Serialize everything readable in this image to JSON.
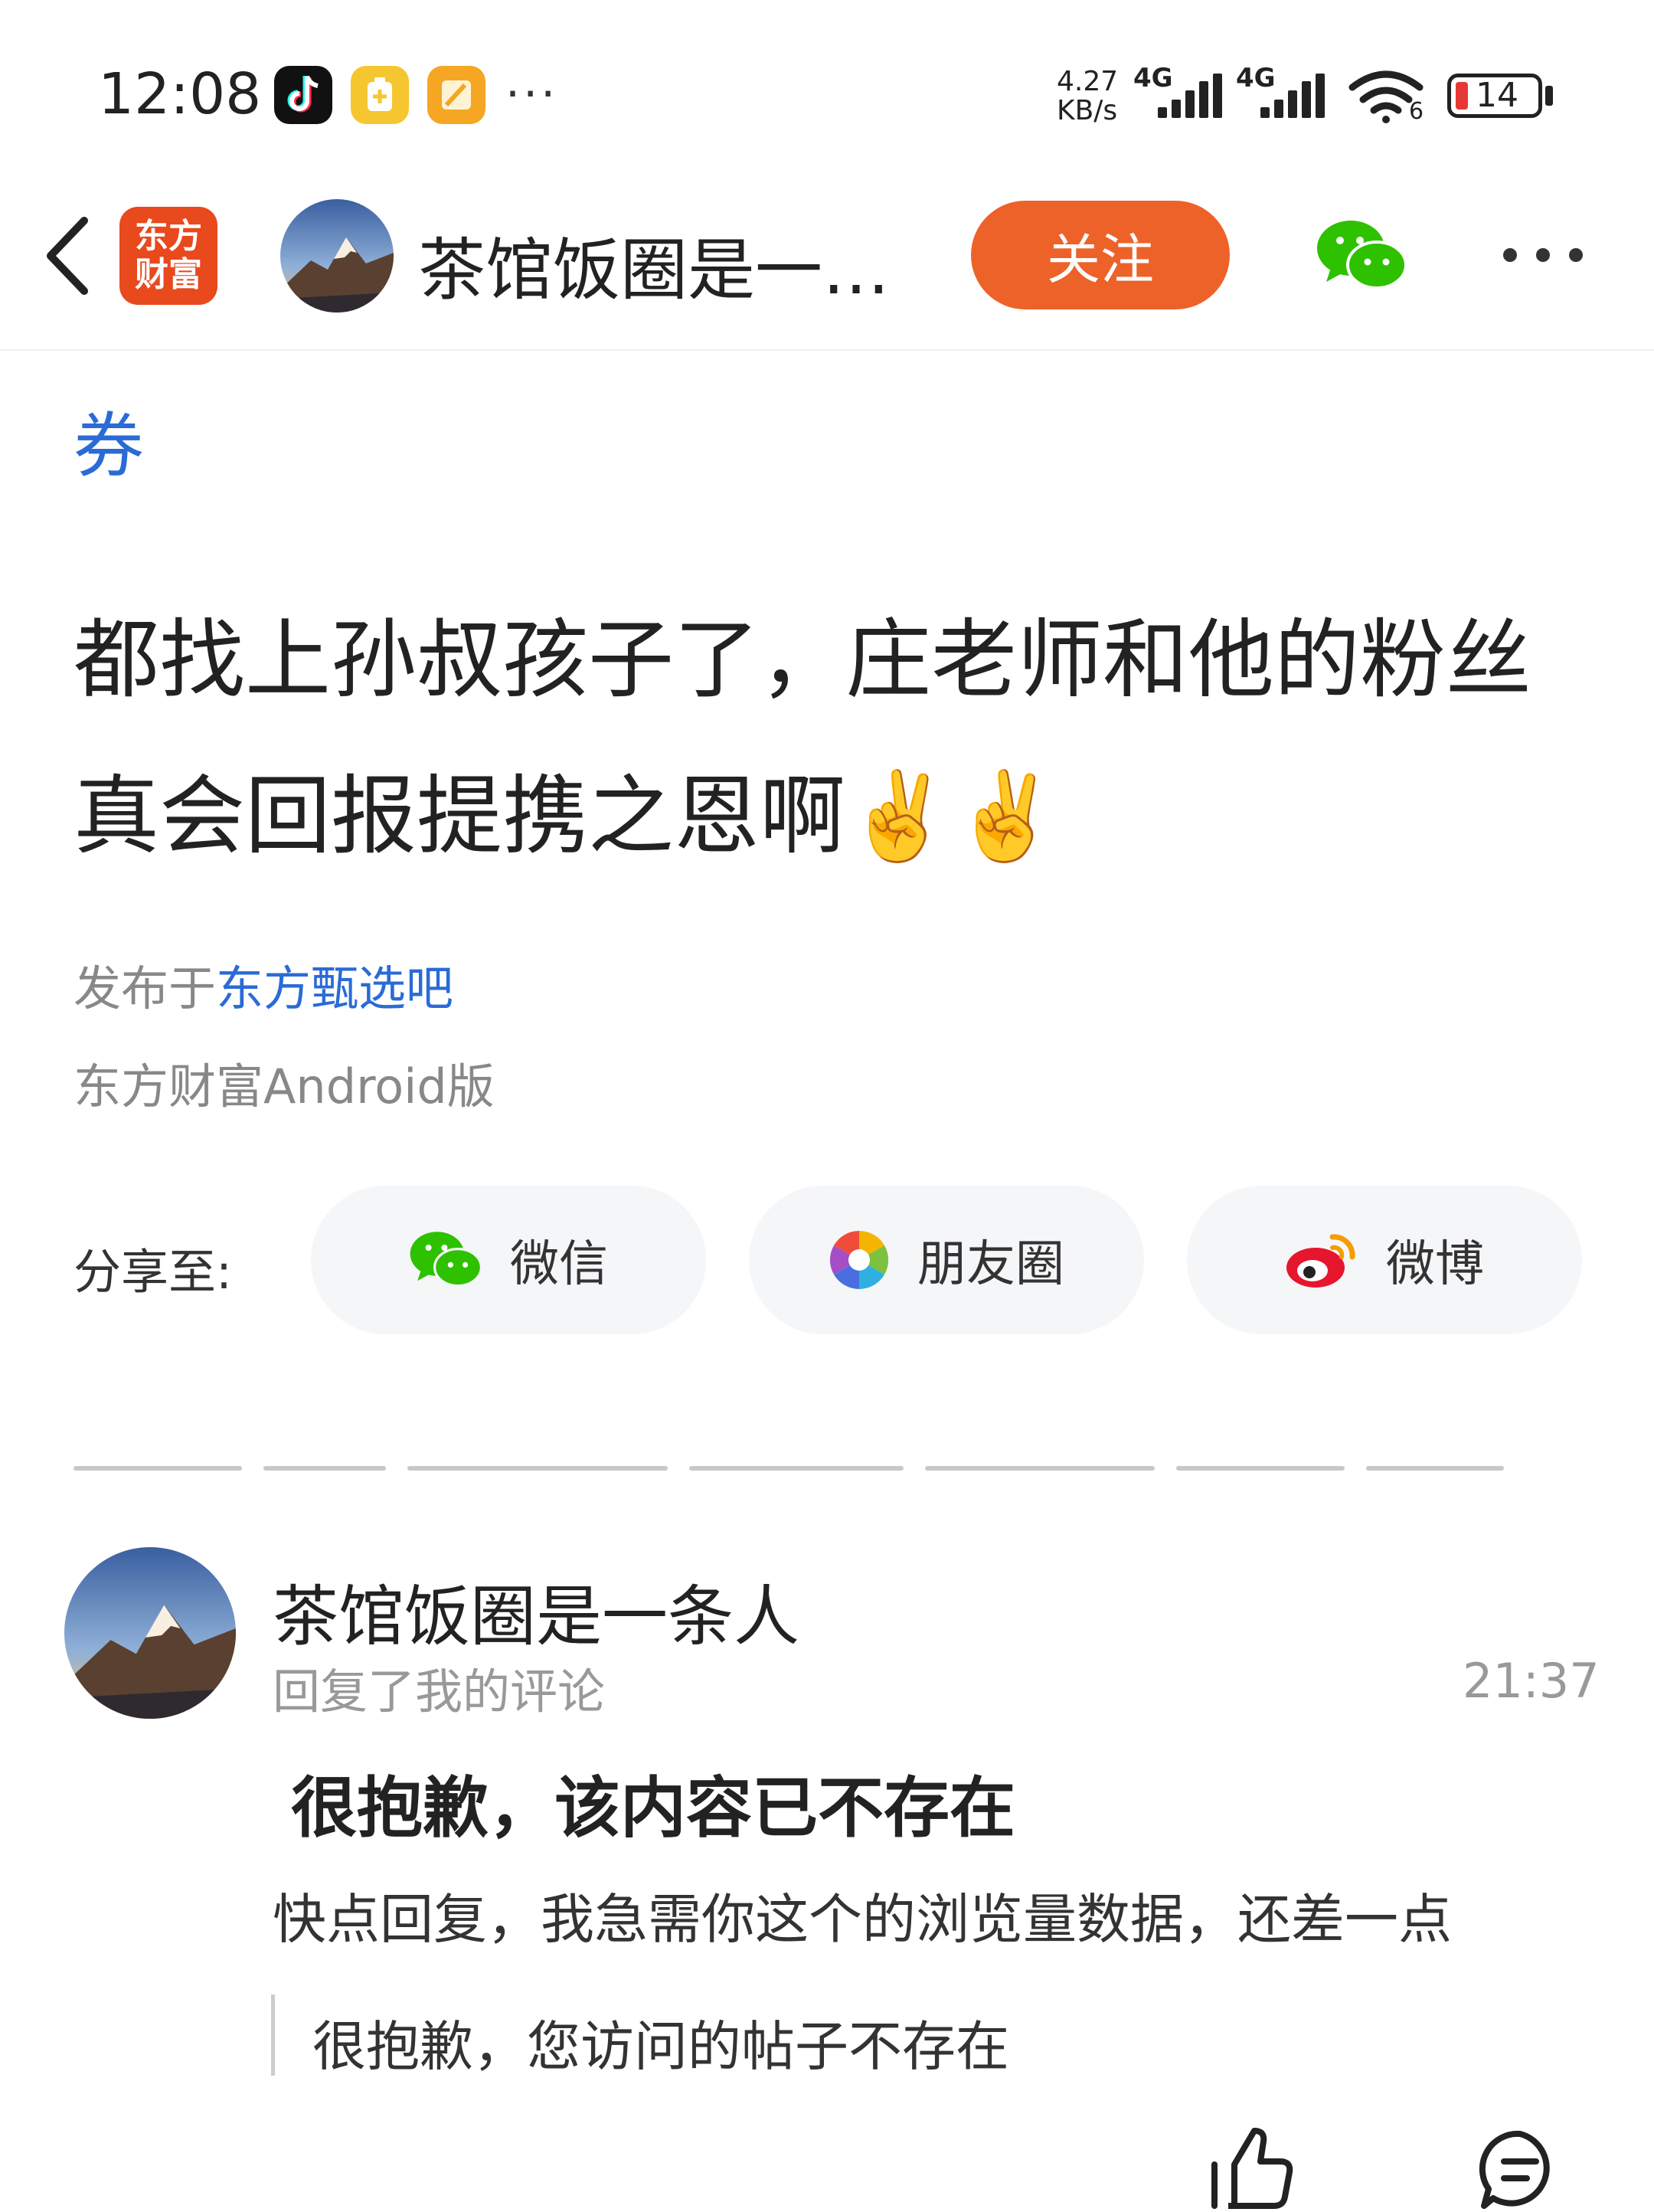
{
  "status_bar": {
    "time": "12:08",
    "dots": "···",
    "net_speed_value": "4.27",
    "net_speed_unit": "KB/s",
    "signal1": "4G",
    "signal2": "4G",
    "wifi_badge": "6",
    "battery": "14",
    "battery_color": "#e53935"
  },
  "header": {
    "logo_line1": "东方",
    "logo_line2": "财富",
    "title": "茶馆饭圈是一…",
    "follow_label": "关注",
    "accent": "#ed6229"
  },
  "post": {
    "tag": "券",
    "title": "都找上孙叔孩子了，庄老师和他的粉丝真会回报提携之恩啊",
    "emoji": "✌️✌️",
    "published_prefix": "发布于",
    "published_link": "东方甄选吧",
    "client": "东方财富Android版",
    "link_color": "#2a6bd6"
  },
  "share": {
    "label": "分享至:",
    "wechat": "微信",
    "moments": "朋友圈",
    "weibo": "微博"
  },
  "comment": {
    "name": "茶馆饭圈是一条人",
    "action": "回复了我的评论",
    "time": "21:37",
    "deleted_notice": "很抱歉，该内容已不存在",
    "reply": "快点回复，我急需你这个的浏览量数据，还差一点",
    "quote": "很抱歉，您访问的帖子不存在"
  }
}
